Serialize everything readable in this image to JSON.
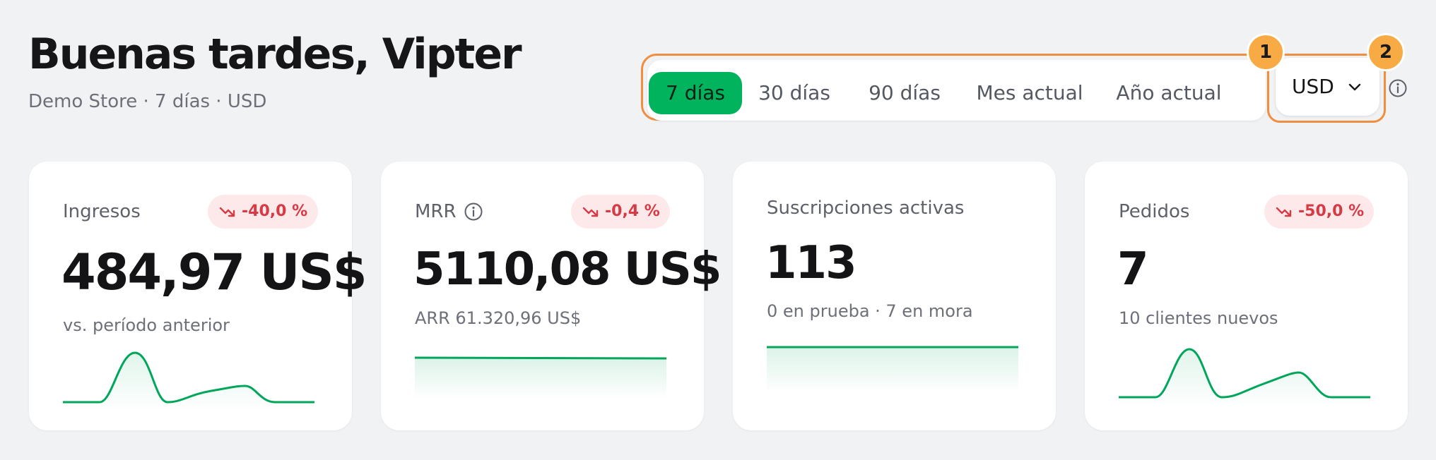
{
  "header": {
    "title": "Buenas tardes, Vipter",
    "subtitle": "Demo Store · 7 días · USD"
  },
  "period_filter": {
    "options": [
      "7 días",
      "30 días",
      "90 días",
      "Mes actual",
      "Año actual"
    ],
    "selected": "7 días"
  },
  "currency": {
    "value": "USD",
    "icon": "chevron-down-icon"
  },
  "markers": [
    "1",
    "2"
  ],
  "colors": {
    "accent": "#00b35c",
    "highlight": "#f08d3f",
    "marker": "#f8ab44",
    "negative": "#d63a45",
    "negative_bg": "#fde9ea"
  },
  "cards": [
    {
      "label": "Ingresos",
      "delta": "-40,0 %",
      "value": "484,97 US$",
      "sub": "vs. período anterior"
    },
    {
      "label": "MRR",
      "delta": "-0,4 %",
      "value": "5110,08 US$",
      "sub": "ARR 61.320,96 US$"
    },
    {
      "label": "Suscripciones activas",
      "delta": "",
      "value": "113",
      "sub": "0 en prueba · 7 en mora"
    },
    {
      "label": "Pedidos",
      "delta": "-50,0 %",
      "value": "7",
      "sub": "10 clientes nuevos"
    }
  ]
}
